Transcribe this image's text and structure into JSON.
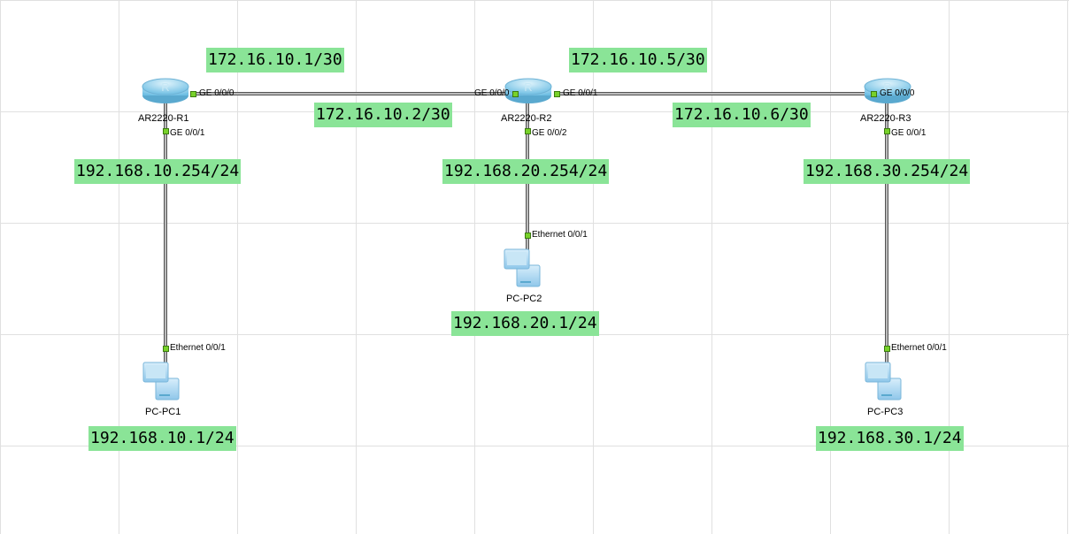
{
  "devices": {
    "r1": {
      "name": "AR2220-R1",
      "ports": {
        "g000": "GE 0/0/0",
        "g001": "GE 0/0/1"
      }
    },
    "r2": {
      "name": "AR2220-R2",
      "ports": {
        "g000": "GE 0/0/0",
        "g001": "GE 0/0/1",
        "g002": "GE 0/0/2"
      }
    },
    "r3": {
      "name": "AR2220-R3",
      "ports": {
        "g000": "GE 0/0/0",
        "g001": "GE 0/0/1"
      }
    },
    "pc1": {
      "name": "PC-PC1",
      "port": "Ethernet 0/0/1"
    },
    "pc2": {
      "name": "PC-PC2",
      "port": "Ethernet 0/0/1"
    },
    "pc3": {
      "name": "PC-PC3",
      "port": "Ethernet 0/0/1"
    }
  },
  "addresses": {
    "r1_g000": "172.16.10.1/30",
    "r2_g000": "172.16.10.2/30",
    "r2_g001": "172.16.10.5/30",
    "r3_g000": "172.16.10.6/30",
    "r1_g001": "192.168.10.254/24",
    "r2_g002": "192.168.20.254/24",
    "r3_g001": "192.168.30.254/24",
    "pc1": "192.168.10.1/24",
    "pc2": "192.168.20.1/24",
    "pc3": "192.168.30.1/24"
  },
  "icons": {
    "router_letter": "R"
  }
}
